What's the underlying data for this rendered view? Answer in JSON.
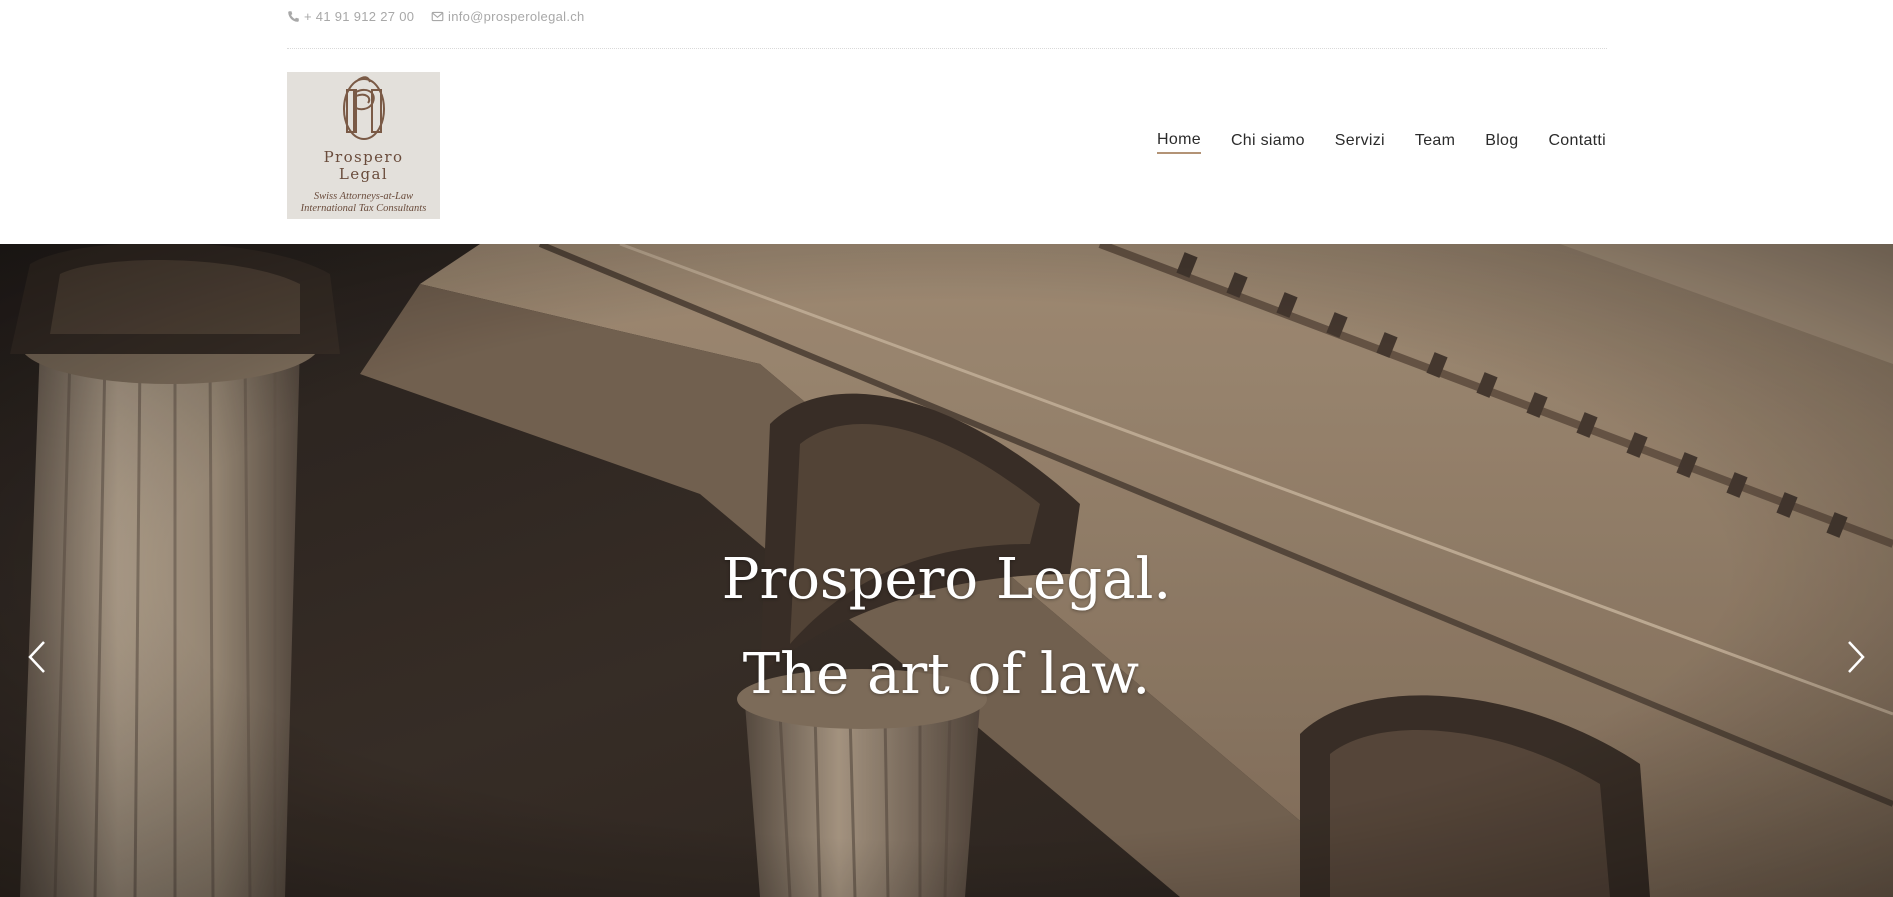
{
  "topbar": {
    "phone": "+ 41 91 912 27 00",
    "email": "info@prosperolegal.ch",
    "phone_icon": "phone-icon",
    "email_icon": "envelope-icon"
  },
  "logo": {
    "name_line1": "Prospero",
    "name_line2": "Legal",
    "tagline1": "Swiss Attorneys-at-Law",
    "tagline2": "International Tax Consultants",
    "background": "#e3e0db",
    "color": "#6a4c3c"
  },
  "nav": {
    "items": [
      {
        "label": "Home",
        "active": true
      },
      {
        "label": "Chi siamo",
        "active": false
      },
      {
        "label": "Servizi",
        "active": false
      },
      {
        "label": "Team",
        "active": false
      },
      {
        "label": "Blog",
        "active": false
      },
      {
        "label": "Contatti",
        "active": false
      }
    ],
    "active_underline_color": "#b39376"
  },
  "hero": {
    "line1": "Prospero Legal.",
    "line2": "The art of law.",
    "prev_icon": "chevron-left-icon",
    "next_icon": "chevron-right-icon"
  }
}
